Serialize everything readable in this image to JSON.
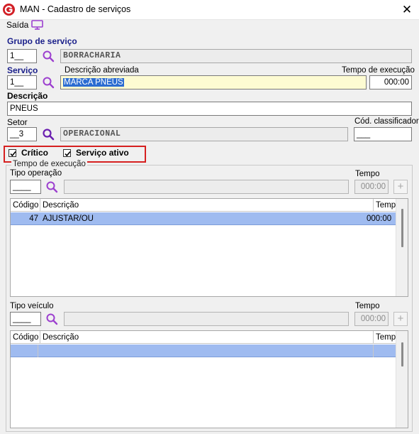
{
  "window": {
    "title": "MAN - Cadastro de serviços",
    "close_label": "✕"
  },
  "menu": {
    "saida_label": "Saída"
  },
  "grupo": {
    "label": "Grupo de serviço",
    "code": "1__",
    "description": "BORRACHARIA"
  },
  "servico": {
    "label": "Serviço",
    "code": "1__",
    "desc_abrev_label": "Descrição abreviada",
    "desc_abrev_value": "MARCA PNEUS",
    "tempo_label": "Tempo de execução",
    "tempo_value": "000:00"
  },
  "descricao": {
    "label": "Descrição",
    "value": "PNEUS"
  },
  "setor": {
    "label": "Setor",
    "code": "__3",
    "description": "OPERACIONAL",
    "cod_class_label": "Cód. classificador",
    "cod_class_value": "___"
  },
  "checks": {
    "critico_label": "Crítico",
    "critico_checked": true,
    "ativo_label": "Serviço ativo",
    "ativo_checked": true
  },
  "tempo_execucao": {
    "group_label": "Tempo de execução",
    "tipo_operacao": {
      "label": "Tipo operação",
      "code": "____",
      "description": "",
      "tempo_label": "Tempo",
      "tempo_value": "000:00",
      "plus": "+"
    },
    "operacoes_table": {
      "columns": [
        "Código",
        "Descrição",
        "Tempo"
      ],
      "rows": [
        {
          "codigo": "47",
          "descricao": "AJUSTAR/OU",
          "tempo": "000:00"
        }
      ]
    },
    "tipo_veiculo": {
      "label": "Tipo veículo",
      "code": "____",
      "description": "",
      "tempo_label": "Tempo",
      "tempo_value": "000:00",
      "plus": "+"
    },
    "veiculos_table": {
      "columns": [
        "Código",
        "Descrição",
        "Tempo"
      ],
      "rows": [
        {
          "codigo": "",
          "descricao": "",
          "tempo": ""
        }
      ]
    }
  },
  "colors": {
    "accent_blue": "#1a1f8a",
    "selection_blue": "#2b6cd1",
    "row_selected": "#9fbbf0",
    "search_icon_purple": "#9c3fcf",
    "highlight_red": "#d62020",
    "yellow_field": "#fdfbd2"
  },
  "icons": {
    "app_logo": "app-logo-icon",
    "monitor": "monitor-icon",
    "search": "search-icon",
    "checkbox": "checkmark-icon"
  }
}
